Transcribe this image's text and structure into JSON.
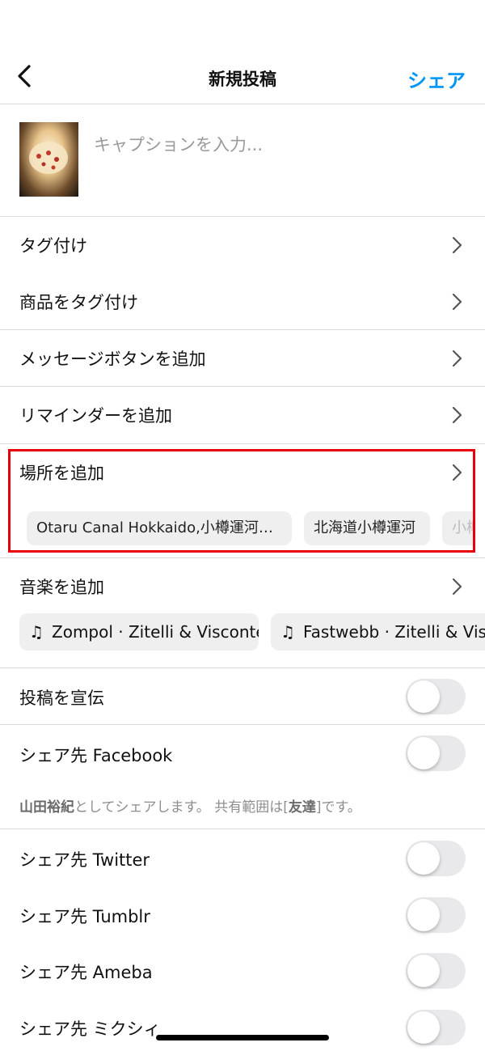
{
  "header": {
    "title": "新規投稿",
    "share_label": "シェア"
  },
  "caption": {
    "placeholder": "キャプションを入力..."
  },
  "menu": {
    "tag": "タグ付け",
    "product_tag": "商品をタグ付け",
    "message_button": "メッセージボタンを追加",
    "reminder": "リマインダーを追加",
    "location": "場所を追加",
    "music": "音楽を追加",
    "promote": "投稿を宣伝"
  },
  "location_suggestions": [
    "Otaru Canal Hokkaido,小樽運河…",
    "北海道小樽運河",
    "小樽"
  ],
  "music_suggestions": [
    "Zompol · Zitelli & Visconte",
    "Fastwebb · Zitelli & Visconte"
  ],
  "share_targets": {
    "facebook": "シェア先 Facebook",
    "twitter": "シェア先 Twitter",
    "tumblr": "シェア先 Tumblr",
    "ameba": "シェア先 Ameba",
    "mixi": "シェア先 ミクシィ"
  },
  "facebook_note": {
    "user": "山田裕紀",
    "middle": "としてシェアします。 共有範囲は[",
    "audience": "友達",
    "end": "]です。"
  },
  "toggles": {
    "promote": false,
    "facebook": false,
    "twitter": false,
    "tumblr": false,
    "ameba": false,
    "mixi": false
  },
  "colors": {
    "accent": "#0095f6",
    "highlight_box": "#e5000b",
    "divider": "#dbdbdb",
    "chip_background": "#efefef",
    "toggle_off": "#e9e9eb"
  },
  "icons": [
    "back-arrow-icon",
    "chevron-right-icon",
    "music-note-icon"
  ]
}
